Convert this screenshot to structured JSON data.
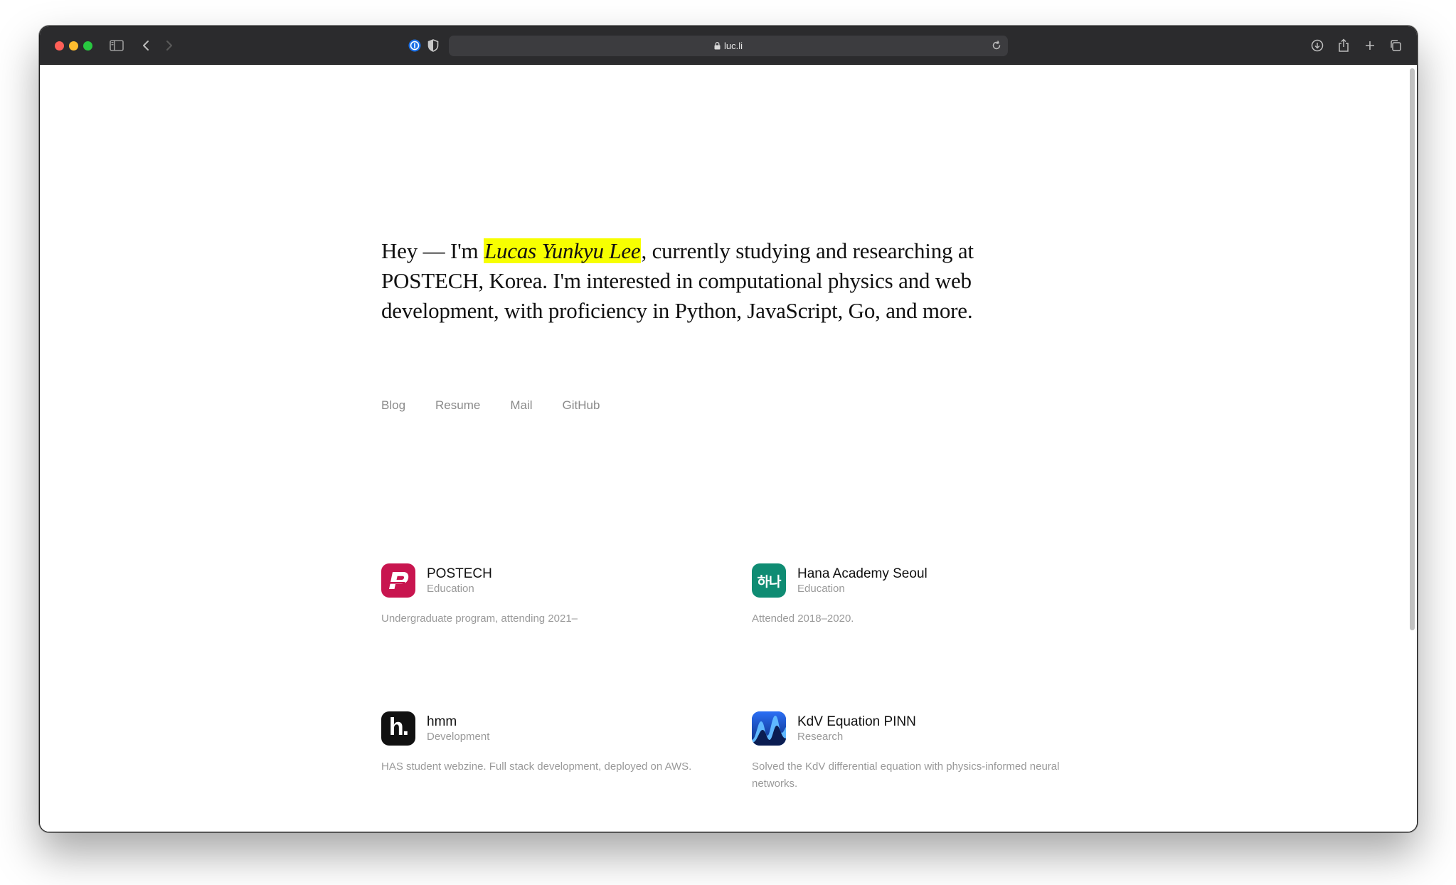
{
  "browser": {
    "url": "luc.li"
  },
  "intro": {
    "before": "Hey — I'm ",
    "name": "Lucas Yunkyu Lee",
    "after": ", currently studying and researching at POSTECH, Korea. I'm interested in computational physics and web development, with proficiency in Python, JavaScript, Go, and more."
  },
  "links": [
    {
      "label": "Blog"
    },
    {
      "label": "Resume"
    },
    {
      "label": "Mail"
    },
    {
      "label": "GitHub"
    }
  ],
  "cards": [
    {
      "title": "POSTECH",
      "category": "Education",
      "description": "Undergraduate program, attending 2021–",
      "icon": "postech-logo",
      "color": "#c8154f"
    },
    {
      "title": "Hana Academy Seoul",
      "category": "Education",
      "description": "Attended 2018–2020.",
      "icon": "hana-logo",
      "icon_text": "하나",
      "color": "#0f8c73"
    },
    {
      "title": "hmm",
      "category": "Development",
      "description": "HAS student webzine. Full stack development, deployed on AWS.",
      "icon": "hmm-logo",
      "icon_text": "h.",
      "color": "#111111"
    },
    {
      "title": "KdV Equation PINN",
      "category": "Research",
      "description": "Solved the KdV differential equation with physics-informed neural networks.",
      "icon": "kdv-logo",
      "color": "#0d3ea8"
    }
  ],
  "colors": {
    "highlight": "#f7ff00",
    "toolbar": "#2b2b2d"
  }
}
